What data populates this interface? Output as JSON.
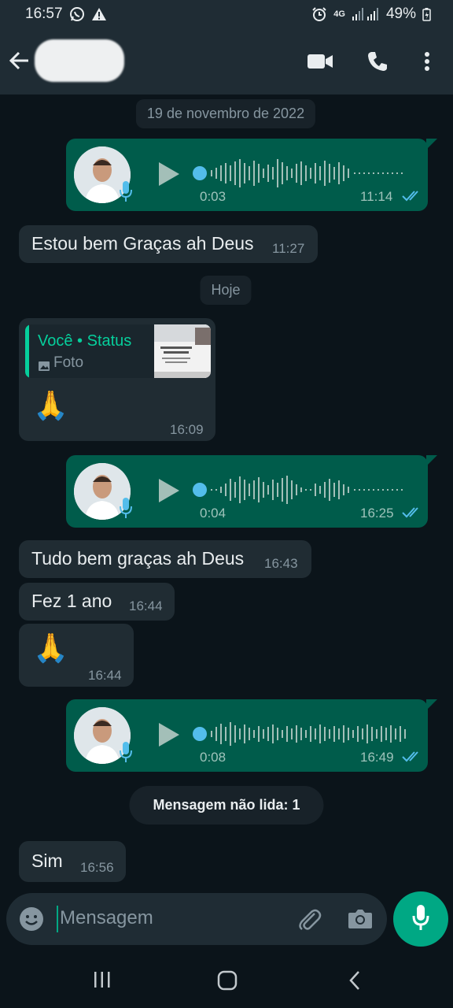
{
  "status_bar": {
    "time": "16:57",
    "network": "4G",
    "battery": "49%"
  },
  "header": {
    "contact_name": ""
  },
  "chat": {
    "date_chips": [
      "19 de novembro de 2022",
      "Hoje"
    ],
    "messages": [
      {
        "type": "voice",
        "direction": "out",
        "duration": "0:03",
        "time": "11:14",
        "status": "read"
      },
      {
        "type": "text",
        "direction": "in",
        "text": "Estou bem Graças ah Deus",
        "time": "11:27"
      },
      {
        "type": "status_reply",
        "direction": "in",
        "reply_title": "Você • Status",
        "reply_subtitle": "Foto",
        "text": "🙏",
        "time": "16:09"
      },
      {
        "type": "voice",
        "direction": "out",
        "duration": "0:04",
        "time": "16:25",
        "status": "read"
      },
      {
        "type": "text",
        "direction": "in",
        "text": "Tudo bem graças ah Deus",
        "time": "16:43"
      },
      {
        "type": "text",
        "direction": "in",
        "text": "Fez 1 ano",
        "time": "16:44"
      },
      {
        "type": "text",
        "direction": "in",
        "text": "🙏",
        "time": "16:44"
      },
      {
        "type": "voice",
        "direction": "out",
        "duration": "0:08",
        "time": "16:49",
        "status": "read"
      },
      {
        "type": "text",
        "direction": "in",
        "text": "Sim",
        "time": "16:56"
      }
    ],
    "unread_label": "Mensagem não lida: 1"
  },
  "composer": {
    "placeholder": "Mensagem"
  },
  "colors": {
    "background": "#0b141a",
    "header": "#1f2c34",
    "incoming_bubble": "#202c33",
    "outgoing_bubble": "#005c4b",
    "accent": "#00a884",
    "read_ticks": "#53bdeb"
  }
}
